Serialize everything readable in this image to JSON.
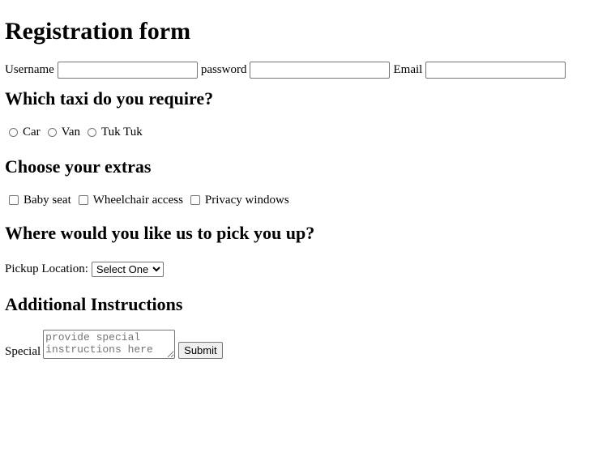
{
  "page": {
    "title": "Registration form"
  },
  "credentials": {
    "username_label": "Username",
    "username_value": "",
    "password_label": "password",
    "password_value": "",
    "email_label": "Email",
    "email_value": ""
  },
  "taxi": {
    "heading": "Which taxi do you require?",
    "options": [
      {
        "label": "Car",
        "checked": false
      },
      {
        "label": "Van",
        "checked": false
      },
      {
        "label": "Tuk Tuk",
        "checked": false
      }
    ]
  },
  "extras": {
    "heading": "Choose your extras",
    "options": [
      {
        "label": "Baby seat",
        "checked": false
      },
      {
        "label": "Wheelchair access",
        "checked": false
      },
      {
        "label": "Privacy windows",
        "checked": false
      }
    ]
  },
  "pickup": {
    "heading": "Where would you like us to pick you up?",
    "label": "Pickup Location:",
    "selected": "Select One"
  },
  "instructions": {
    "heading": "Additional Instructions",
    "label": "Special",
    "placeholder": "provide special instructions here",
    "value": "",
    "submit_label": "Submit"
  }
}
